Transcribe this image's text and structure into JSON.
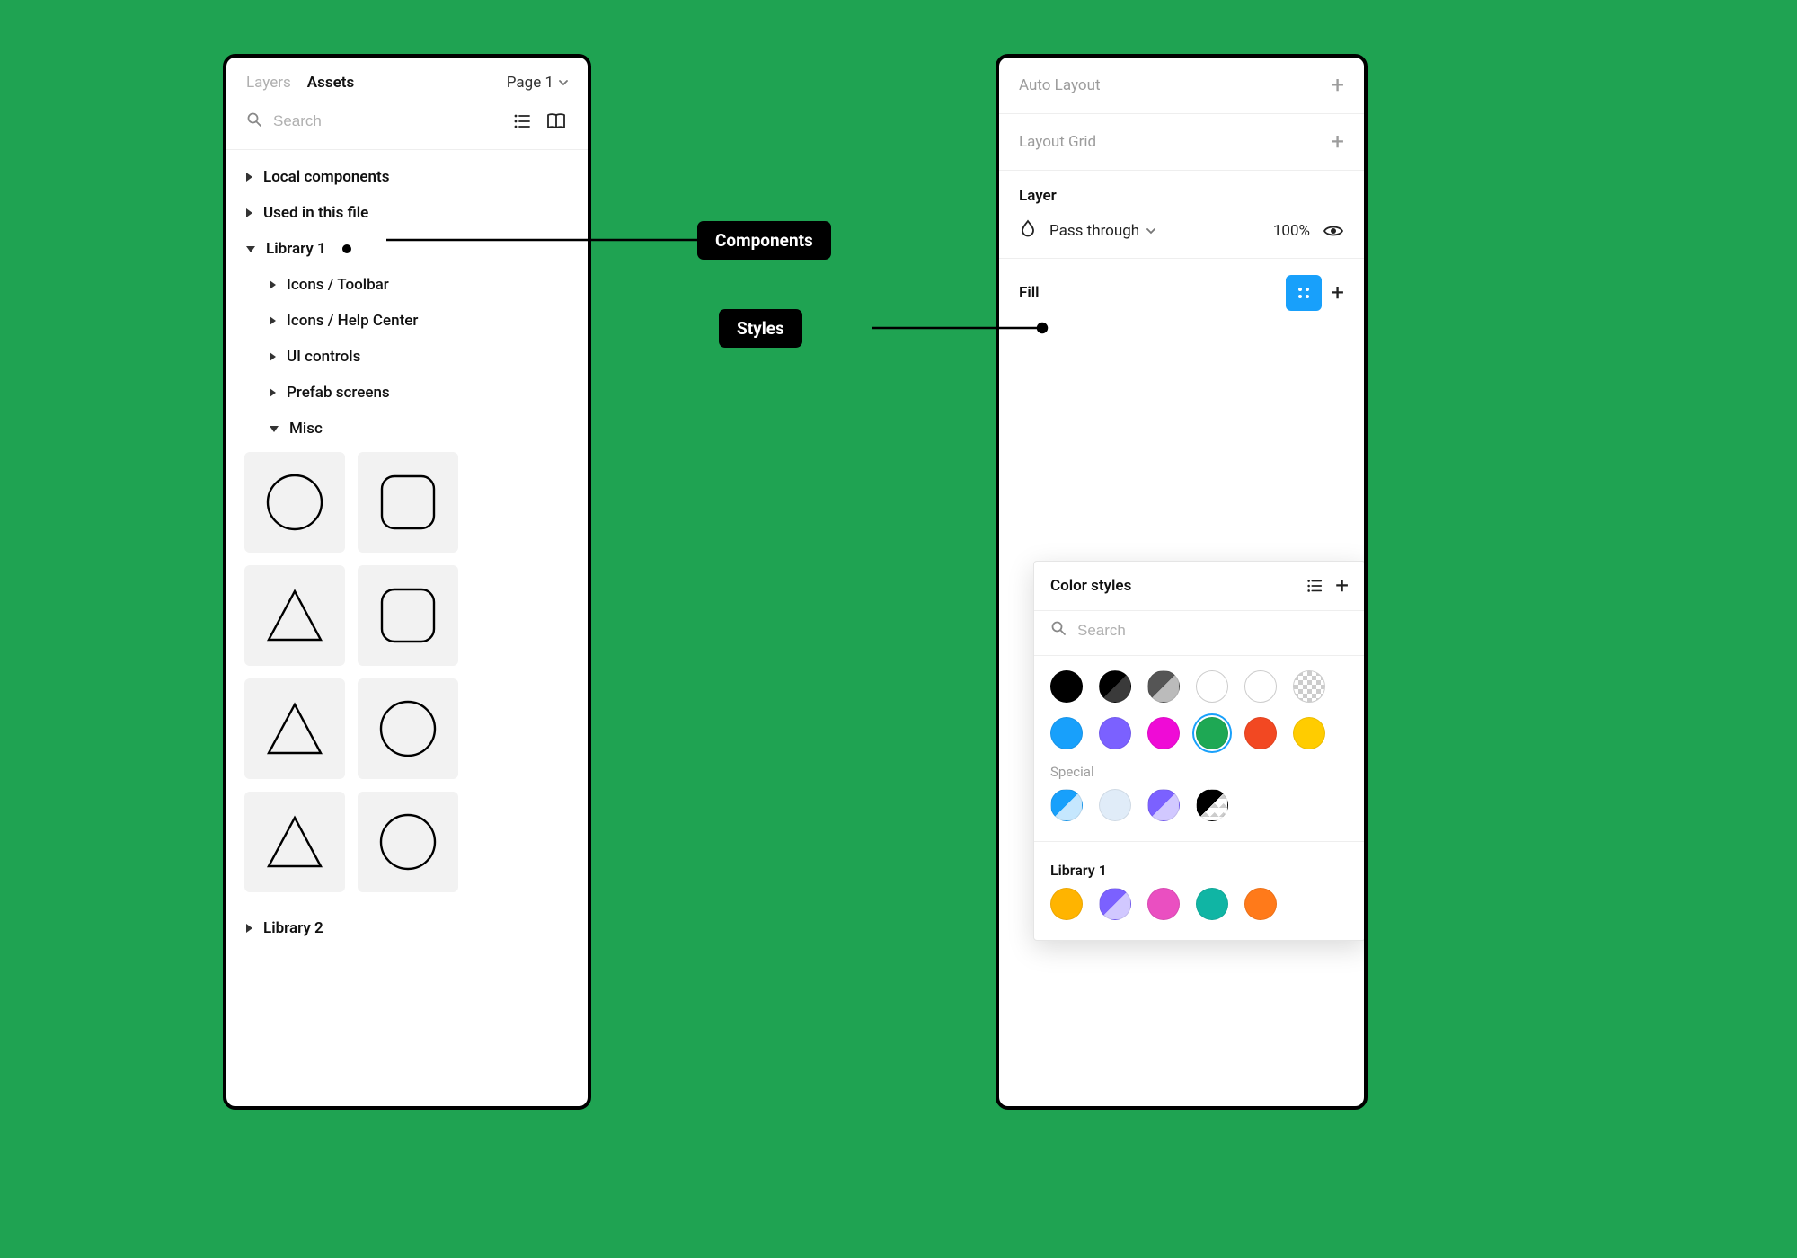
{
  "left_panel": {
    "tabs": {
      "layers": "Layers",
      "assets": "Assets",
      "active": "Assets"
    },
    "page_selector": "Page 1",
    "search_placeholder": "Search",
    "tree": {
      "local_components": "Local components",
      "used_in_file": "Used in this file",
      "library1": {
        "label": "Library 1",
        "children": {
          "icons_toolbar": "Icons / Toolbar",
          "icons_help": "Icons / Help Center",
          "ui_controls": "UI controls",
          "prefab_screens": "Prefab screens",
          "misc": "Misc"
        }
      },
      "library2": "Library 2"
    },
    "shapes": [
      "circle",
      "rounded-square",
      "triangle",
      "rounded-square",
      "triangle",
      "circle",
      "triangle",
      "circle"
    ]
  },
  "right_panel": {
    "auto_layout_label": "Auto Layout",
    "layout_grid_label": "Layout Grid",
    "layer_label": "Layer",
    "blend_mode": "Pass through",
    "opacity": "100%",
    "fill_label": "Fill",
    "styles_popover": {
      "title": "Color styles",
      "search_placeholder": "Search",
      "row1": [
        {
          "name": "black",
          "style": "background:#000"
        },
        {
          "name": "black-gloss",
          "style": "background:linear-gradient(135deg,#000 50%,#3a3a3a 50%)"
        },
        {
          "name": "grey-gloss",
          "style": "background:linear-gradient(135deg,#555 50%,#bbb 50%)"
        },
        {
          "name": "white-outline",
          "class": "outline"
        },
        {
          "name": "white-outline-2",
          "class": "outline"
        },
        {
          "name": "transparent",
          "class": "checker"
        }
      ],
      "row2": [
        {
          "name": "blue",
          "style": "background:#18a0fb"
        },
        {
          "name": "purple",
          "style": "background:#7b61ff"
        },
        {
          "name": "magenta",
          "style": "background:#ef0bd6"
        },
        {
          "name": "green",
          "style": "background:#1ea854",
          "selected": true
        },
        {
          "name": "red",
          "style": "background:#f24822"
        },
        {
          "name": "yellow",
          "style": "background:#ffcc00"
        }
      ],
      "special_label": "Special",
      "special_row": [
        {
          "name": "blue-half",
          "class": "half-blue"
        },
        {
          "name": "light-blue",
          "style": "background:#e0ecf8"
        },
        {
          "name": "purple-half",
          "class": "half-purple"
        },
        {
          "name": "black-half-check",
          "class": "half-black-check"
        }
      ],
      "library1_label": "Library 1",
      "library1_row": [
        {
          "name": "amber",
          "style": "background:#ffb400"
        },
        {
          "name": "lib-purple-half",
          "class": "half-purple"
        },
        {
          "name": "pink",
          "style": "background:#ea4fc1"
        },
        {
          "name": "teal",
          "style": "background:#10b5a4"
        },
        {
          "name": "orange",
          "style": "background:#ff7a1a"
        }
      ]
    }
  },
  "callouts": {
    "components": "Components",
    "styles": "Styles"
  }
}
